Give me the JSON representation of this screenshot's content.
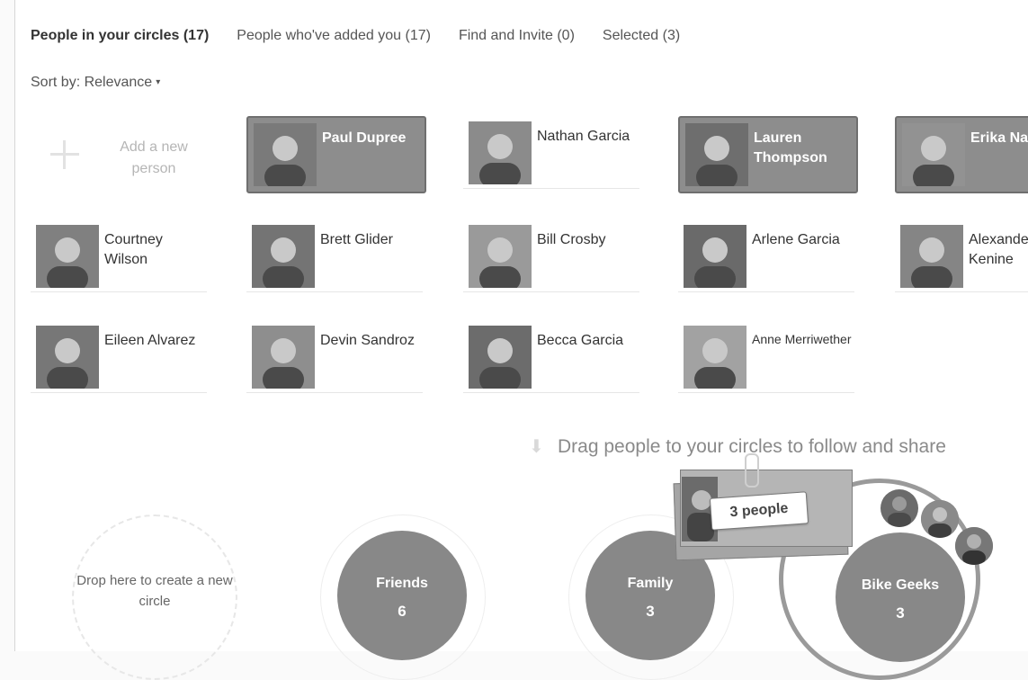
{
  "tabs": [
    {
      "label": "People in your circles (17)",
      "active": true
    },
    {
      "label": "People who've added you (17)",
      "active": false
    },
    {
      "label": "Find and Invite (0)",
      "active": false
    },
    {
      "label": "Selected (3)",
      "active": false
    }
  ],
  "sort": {
    "label": "Sort by: Relevance",
    "caret": "▾"
  },
  "add_person": {
    "label": "Add a new person"
  },
  "people": [
    {
      "name": "Paul Dupree",
      "selected": true
    },
    {
      "name": "Nathan Garcia",
      "selected": false
    },
    {
      "name": "Lauren Thompson",
      "selected": true
    },
    {
      "name": "Erika Nansen",
      "selected": true
    },
    {
      "name": "Courtney Wilson",
      "selected": false
    },
    {
      "name": "Brett Glider",
      "selected": false
    },
    {
      "name": "Bill Crosby",
      "selected": false
    },
    {
      "name": "Arlene Garcia",
      "selected": false
    },
    {
      "name": "Alexander Kenine",
      "selected": false
    },
    {
      "name": "Eileen Alvarez",
      "selected": false
    },
    {
      "name": "Devin Sandroz",
      "selected": false
    },
    {
      "name": "Becca Garcia",
      "selected": false
    },
    {
      "name": "Anne Merriwether",
      "selected": false
    }
  ],
  "drag_hint": "Drag people to your circles to follow and share",
  "drag_badge": "3 people",
  "drop_zone": {
    "label": "Drop here to create a new circle"
  },
  "circles": [
    {
      "name": "Friends",
      "count": "6"
    },
    {
      "name": "Family",
      "count": "3"
    },
    {
      "name": "Bike Geeks",
      "count": "3"
    }
  ],
  "colors": {
    "selected_card": "#8d8d8d",
    "circle": "#888888",
    "text": "#444444"
  }
}
